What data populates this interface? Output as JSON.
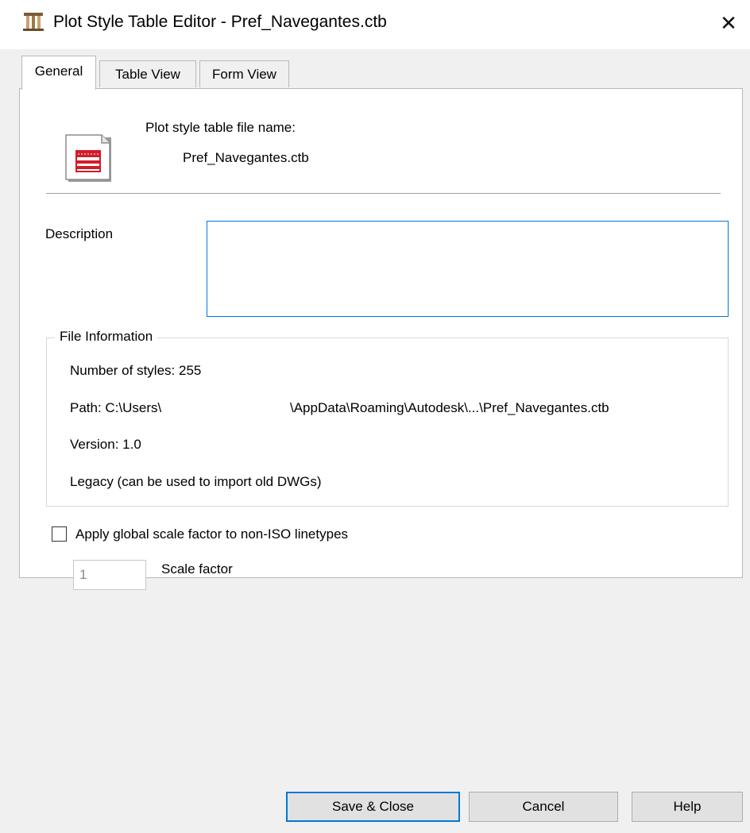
{
  "window": {
    "title": "Plot Style Table Editor - Pref_Navegantes.ctb",
    "close_label": "✕"
  },
  "tabs": [
    {
      "label": "General",
      "active": true
    },
    {
      "label": "Table View",
      "active": false
    },
    {
      "label": "Form View",
      "active": false
    }
  ],
  "general": {
    "file_name_label": "Plot style table file name:",
    "file_name": "Pref_Navegantes.ctb",
    "description_label": "Description",
    "description_value": "",
    "file_info": {
      "title": "File Information",
      "number_of_styles": "Number of styles: 255",
      "path_prefix": "Path: C:\\Users\\",
      "path_suffix": "\\AppData\\Roaming\\Autodesk\\...\\Pref_Navegantes.ctb",
      "version": "Version: 1.0",
      "legacy": "Legacy (can be used to import old DWGs)"
    },
    "apply_scale_label": "Apply global scale factor to non-ISO linetypes",
    "apply_scale_checked": false,
    "scale_factor_value": "1",
    "scale_factor_label": "Scale factor"
  },
  "buttons": {
    "save_close": "Save & Close",
    "cancel": "Cancel",
    "help": "Help"
  },
  "colors": {
    "accent": "#0078d7",
    "icon_red": "#d21c2a"
  },
  "icons": {
    "app": "plot-style-app-icon",
    "file": "ctb-file-icon",
    "close": "close-icon"
  }
}
